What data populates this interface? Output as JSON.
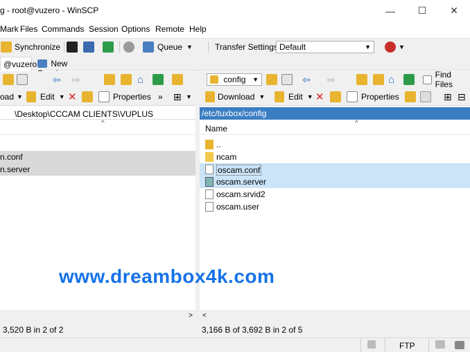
{
  "window": {
    "title": "g - root@vuzero - WinSCP",
    "minimize": "—",
    "maximize": "☐",
    "close": "✕"
  },
  "menu": [
    "Mark",
    "Files",
    "Commands",
    "Session",
    "Options",
    "Remote",
    "Help"
  ],
  "toolbar": {
    "synchronize": "Synchronize",
    "queue": "Queue",
    "transfer_settings_label": "Transfer Settings",
    "transfer_settings_value": "Default"
  },
  "tabs": [
    {
      "label": "@vuzero",
      "active": true
    },
    {
      "label": "New Session",
      "active": false
    }
  ],
  "left_panel": {
    "toolbar": {
      "download": "oad",
      "edit": "Edit",
      "properties": "Properties",
      "more": "»"
    },
    "path": "\\Desktop\\CCCAM CLIENTS\\VUPLUS ZERO\\oscam",
    "files": [
      "n.conf",
      "n.server"
    ],
    "status": "3,520 B in 2 of 2"
  },
  "right_panel": {
    "dir_select": "config",
    "find_files": "Find Files",
    "toolbar": {
      "download": "Download",
      "edit": "Edit",
      "properties": "Properties"
    },
    "path": "/etc/tuxbox/config",
    "column_name": "Name",
    "files": [
      "..",
      "ncam",
      "oscam.conf",
      "oscam.server",
      "oscam.srvid2",
      "oscam.user"
    ],
    "status": "3,166 B of 3,692 B in 2 of 5"
  },
  "watermark": "www.dreambox4k.com",
  "bottom": {
    "protocol": "FTP"
  }
}
